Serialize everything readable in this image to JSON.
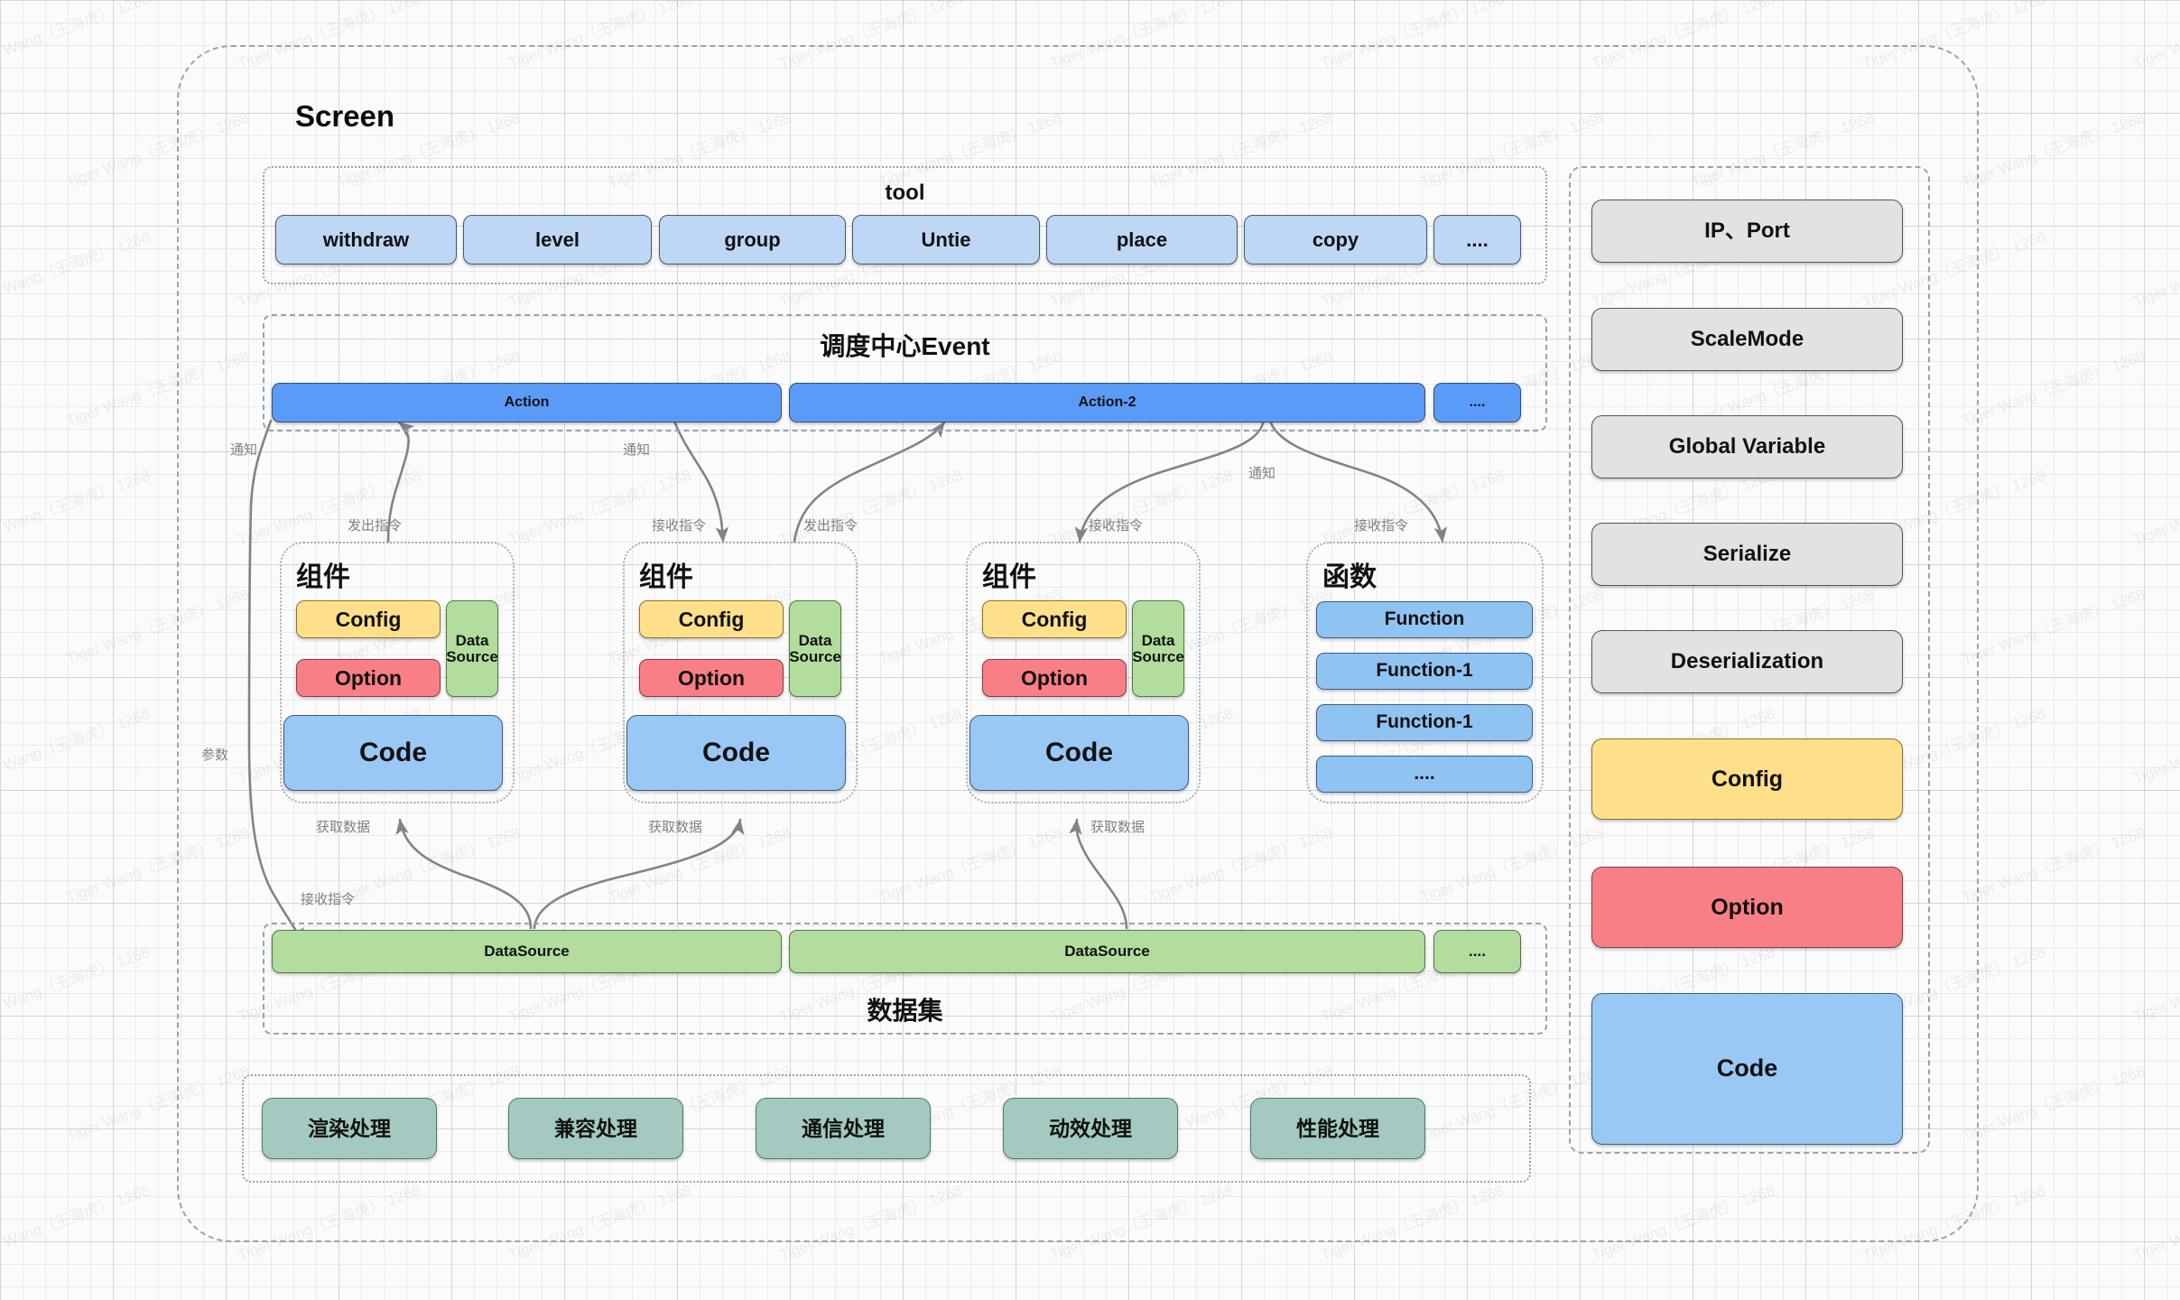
{
  "screen": {
    "title": "Screen"
  },
  "tool": {
    "title": "tool",
    "items": [
      {
        "label": "withdraw"
      },
      {
        "label": "level"
      },
      {
        "label": "group"
      },
      {
        "label": "Untie"
      },
      {
        "label": "place"
      },
      {
        "label": "copy"
      },
      {
        "label": "...."
      }
    ]
  },
  "event": {
    "title": "调度中心Event",
    "items": [
      {
        "label": "Action"
      },
      {
        "label": "Action-2"
      },
      {
        "label": "...."
      }
    ]
  },
  "components": [
    {
      "title": "组件",
      "config": "Config",
      "option": "Option",
      "datasource": "Data Source",
      "code": "Code"
    },
    {
      "title": "组件",
      "config": "Config",
      "option": "Option",
      "datasource": "Data Source",
      "code": "Code"
    },
    {
      "title": "组件",
      "config": "Config",
      "option": "Option",
      "datasource": "Data Source",
      "code": "Code"
    }
  ],
  "function_group": {
    "title": "函数",
    "items": [
      {
        "label": "Function"
      },
      {
        "label": "Function-1"
      },
      {
        "label": "Function-1"
      },
      {
        "label": "...."
      }
    ]
  },
  "dataset": {
    "title": "数据集",
    "items": [
      {
        "label": "DataSource"
      },
      {
        "label": "DataSource"
      },
      {
        "label": "...."
      }
    ]
  },
  "processing": {
    "items": [
      {
        "label": "渲染处理"
      },
      {
        "label": "兼容处理"
      },
      {
        "label": "通信处理"
      },
      {
        "label": "动效处理"
      },
      {
        "label": "性能处理"
      }
    ]
  },
  "sidebar": {
    "items": [
      {
        "label": "IP、Port",
        "kind": "grey"
      },
      {
        "label": "ScaleMode",
        "kind": "grey"
      },
      {
        "label": "Global Variable",
        "kind": "grey"
      },
      {
        "label": "Serialize",
        "kind": "grey"
      },
      {
        "label": "Deserialization",
        "kind": "grey"
      },
      {
        "label": "Config",
        "kind": "config"
      },
      {
        "label": "Option",
        "kind": "option"
      },
      {
        "label": "Code",
        "kind": "code"
      }
    ]
  },
  "edge_labels": [
    {
      "id": "notify-1",
      "text": "通知"
    },
    {
      "id": "notify-2",
      "text": "通知"
    },
    {
      "id": "notify-3",
      "text": "通知"
    },
    {
      "id": "emit-1",
      "text": "发出指令"
    },
    {
      "id": "recv-1",
      "text": "接收指令"
    },
    {
      "id": "emit-2",
      "text": "发出指令"
    },
    {
      "id": "recv-2",
      "text": "接收指令"
    },
    {
      "id": "recv-3",
      "text": "接收指令"
    },
    {
      "id": "param",
      "text": "参数"
    },
    {
      "id": "recv-ds",
      "text": "接收指令"
    },
    {
      "id": "fetch-1",
      "text": "获取数据"
    },
    {
      "id": "fetch-2",
      "text": "获取数据"
    },
    {
      "id": "fetch-3",
      "text": "获取数据"
    }
  ],
  "colors": {
    "tool": "#bdd7f5",
    "action": "#5b9bf8",
    "config": "#ffe08a",
    "option": "#f97f86",
    "datasource": "#b2dd9d",
    "code": "#9ac8f5",
    "processing": "#a3c9c0",
    "grey": "#e2e2e2",
    "dash": "#9aa3ab",
    "edge": "#808488"
  },
  "watermark": {
    "text": "Tiger Wang（王海虎） 1268"
  }
}
